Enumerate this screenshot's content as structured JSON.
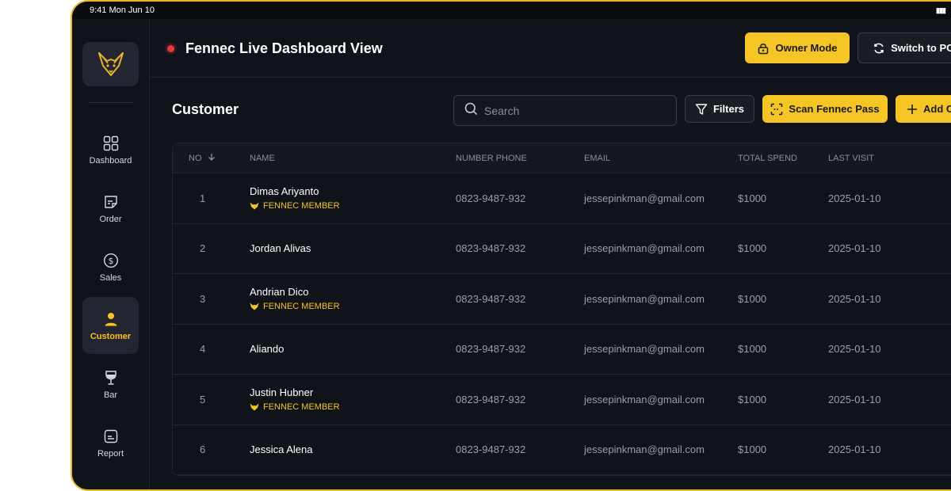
{
  "status_bar": {
    "time": "9:41  Mon Jun 10",
    "signal": "▮▮▮"
  },
  "sidebar": {
    "items": [
      {
        "label": "Dashboard",
        "icon": "grid-icon"
      },
      {
        "label": "Order",
        "icon": "order-icon"
      },
      {
        "label": "Sales",
        "icon": "dollar-icon"
      },
      {
        "label": "Customer",
        "icon": "user-icon",
        "active": true
      },
      {
        "label": "Bar",
        "icon": "wine-glass-icon"
      },
      {
        "label": "Report",
        "icon": "report-icon"
      }
    ]
  },
  "header": {
    "title": "Fennec Live Dashboard View",
    "owner_mode_label": "Owner Mode",
    "switch_label": "Switch to POS"
  },
  "toolbar": {
    "section_title": "Customer",
    "search_placeholder": "Search",
    "filters_label": "Filters",
    "scan_label": "Scan Fennec Pass",
    "add_label": "Add Customer"
  },
  "table": {
    "columns": [
      "NO",
      "NAME",
      "NUMBER PHONE",
      "EMAIL",
      "TOTAL SPEND",
      "LAST VISIT"
    ],
    "rows": [
      {
        "no": "1",
        "name": "Dimas Ariyanto",
        "member": "FENNEC MEMBER",
        "phone": "0823-9487-932",
        "email": "jessepinkman@gmail.com",
        "spend": "$1000",
        "last_visit": "2025-01-10"
      },
      {
        "no": "2",
        "name": "Jordan Alivas",
        "member": "",
        "phone": "0823-9487-932",
        "email": "jessepinkman@gmail.com",
        "spend": "$1000",
        "last_visit": "2025-01-10"
      },
      {
        "no": "3",
        "name": "Andrian Dico",
        "member": "FENNEC MEMBER",
        "phone": "0823-9487-932",
        "email": "jessepinkman@gmail.com",
        "spend": "$1000",
        "last_visit": "2025-01-10"
      },
      {
        "no": "4",
        "name": "Aliando",
        "member": "",
        "phone": "0823-9487-932",
        "email": "jessepinkman@gmail.com",
        "spend": "$1000",
        "last_visit": "2025-01-10"
      },
      {
        "no": "5",
        "name": "Justin Hubner",
        "member": "FENNEC MEMBER",
        "phone": "0823-9487-932",
        "email": "jessepinkman@gmail.com",
        "spend": "$1000",
        "last_visit": "2025-01-10"
      },
      {
        "no": "6",
        "name": "Jessica Alena",
        "member": "",
        "phone": "0823-9487-932",
        "email": "jessepinkman@gmail.com",
        "spend": "$1000",
        "last_visit": "2025-01-10"
      }
    ]
  },
  "colors": {
    "accent": "#f5c425",
    "background": "#11131a",
    "live": "#e5383b",
    "frame": "#e8b62a"
  }
}
